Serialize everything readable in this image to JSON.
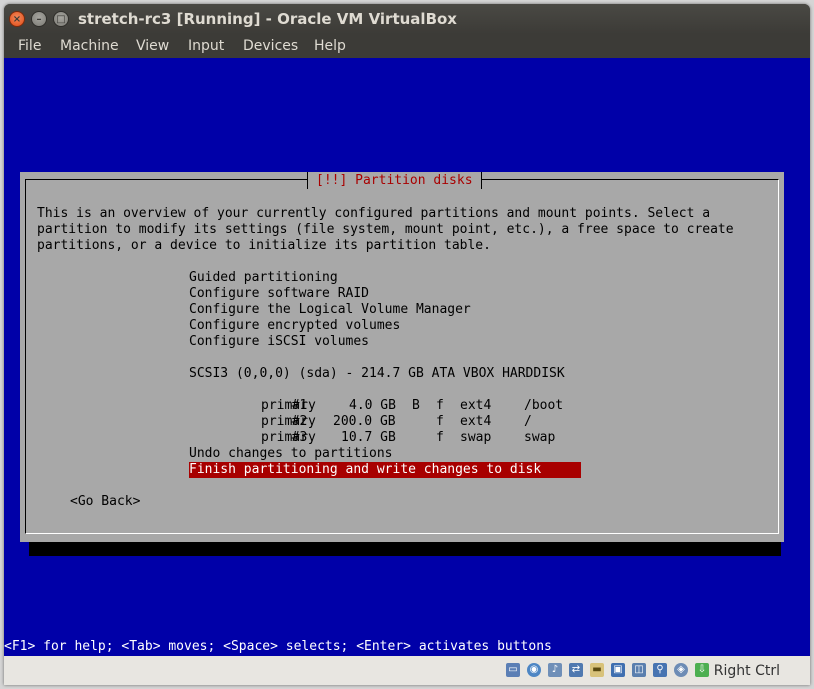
{
  "window": {
    "title": "stretch-rc3 [Running] - Oracle VM VirtualBox"
  },
  "menu": [
    "File",
    "Machine",
    "View",
    "Input",
    "Devices",
    "Help"
  ],
  "dialog": {
    "title": "[!!] Partition disks",
    "intro": [
      "This is an overview of your currently configured partitions and mount points. Select a",
      "partition to modify its settings (file system, mount point, etc.), a free space to create",
      "partitions, or a device to initialize its partition table."
    ],
    "options": [
      "Guided partitioning",
      "Configure software RAID",
      "Configure the Logical Volume Manager",
      "Configure encrypted volumes",
      "Configure iSCSI volumes"
    ],
    "disk": "SCSI3 (0,0,0) (sda) - 214.7 GB ATA VBOX HARDDISK",
    "partitions": [
      {
        "num": "#1",
        "type": "primary",
        "size": "4.0 GB",
        "bootable": "B",
        "format": "f",
        "fs": "ext4",
        "mount": "/boot"
      },
      {
        "num": "#2",
        "type": "primary",
        "size": "200.0 GB",
        "bootable": "",
        "format": "f",
        "fs": "ext4",
        "mount": "/"
      },
      {
        "num": "#3",
        "type": "primary",
        "size": "10.7 GB",
        "bootable": "",
        "format": "f",
        "fs": "swap",
        "mount": "swap"
      }
    ],
    "undo": "Undo changes to partitions",
    "finish": "Finish partitioning and write changes to disk",
    "go_back": "<Go Back>"
  },
  "help_line": "<F1> for help; <Tab> moves; <Space> selects; <Enter> activates buttons",
  "statusbar": {
    "icons": [
      "hard-disk-icon",
      "optical-drive-icon",
      "audio-icon",
      "network-icon",
      "shared-folders-icon",
      "display-icon",
      "video-capture-icon",
      "usb-icon",
      "cpu-virtualization-icon",
      "mouse-integration-icon"
    ],
    "host_key": "Right Ctrl"
  }
}
